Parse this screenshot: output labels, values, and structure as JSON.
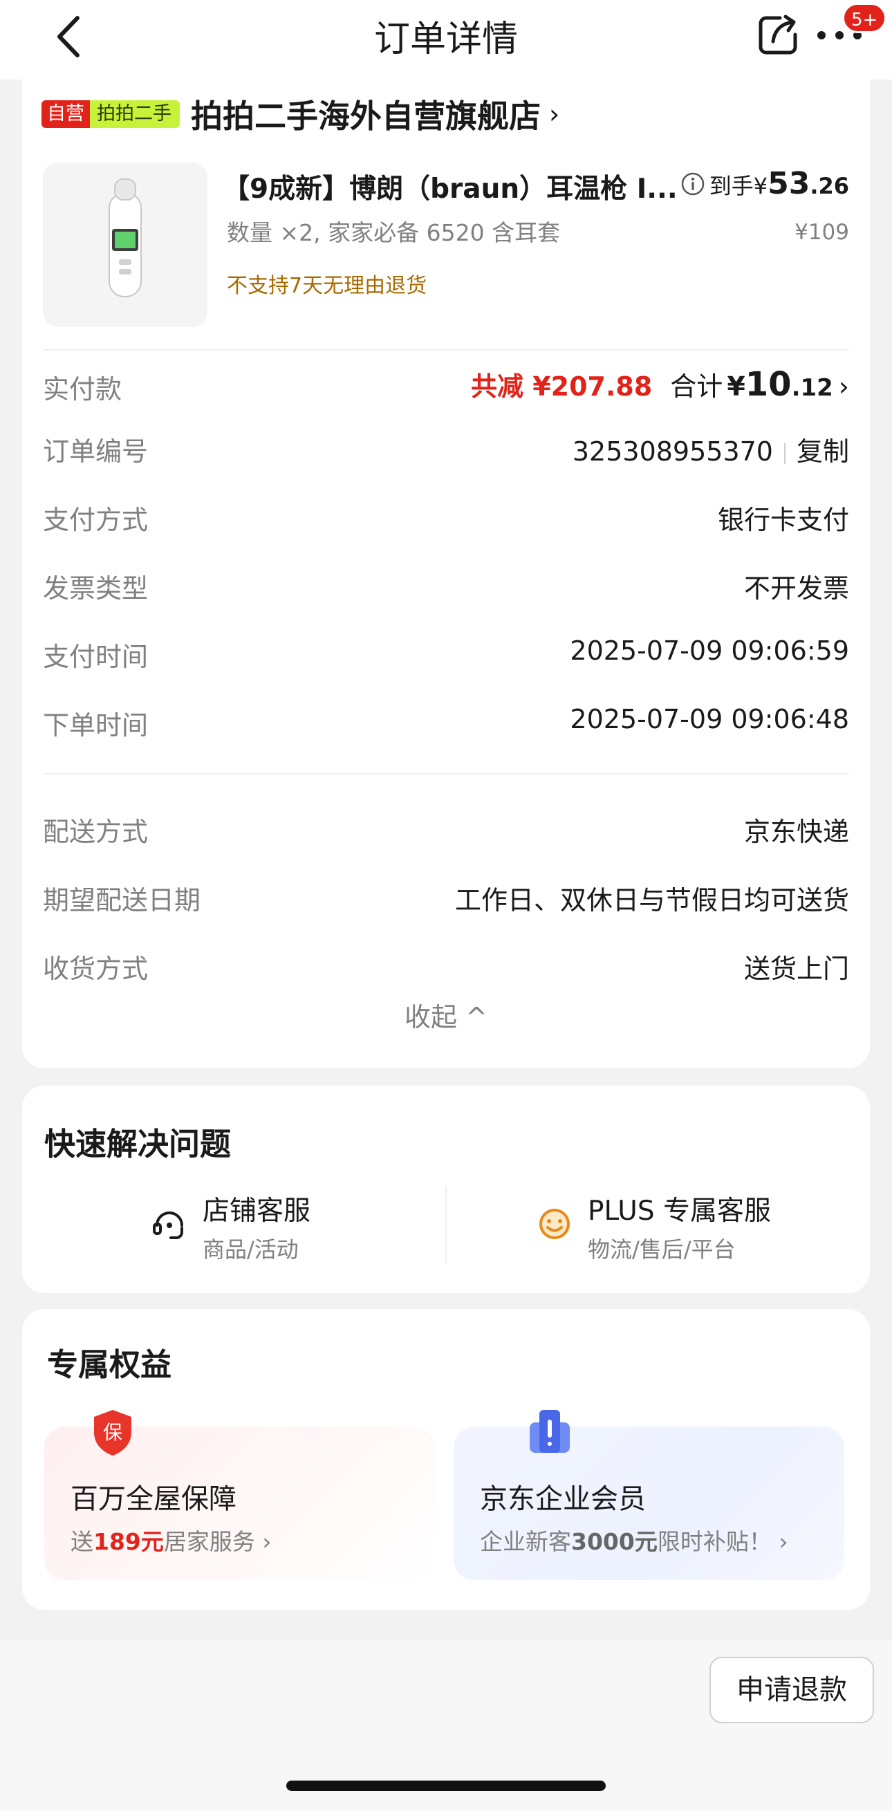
{
  "nav": {
    "title": "订单详情",
    "badge": "5+"
  },
  "store": {
    "tag_self": "自营",
    "tag_second": "拍拍二手",
    "name": "拍拍二手海外自营旗舰店",
    "arrow": "›"
  },
  "product": {
    "title": "【9成新】博朗（braun）耳温枪 I...",
    "spec": "数量 ×2, 家家必备 6520 含耳套",
    "policy": "不支持7天无理由退货",
    "price_label": "到手",
    "price_yen": "¥",
    "price_int": "53",
    "price_dec": ".26",
    "original_price": "¥109"
  },
  "payment": {
    "label": "实付款",
    "reduce": "共减 ¥207.88",
    "sum_label": "合计",
    "sum_yen": "¥",
    "sum_int": "10",
    "sum_dec": ".12",
    "arrow": "›"
  },
  "details": [
    {
      "label": "订单编号",
      "value": "325308955370"
    },
    {
      "label": "支付方式",
      "value": "银行卡支付"
    },
    {
      "label": "发票类型",
      "value": "不开发票"
    },
    {
      "label": "支付时间",
      "value": "2025-07-09 09:06:59"
    },
    {
      "label": "下单时间",
      "value": "2025-07-09 09:06:48"
    },
    {
      "label": "配送方式",
      "value": "京东快递"
    },
    {
      "label": "期望配送日期",
      "value": "工作日、双休日与节假日均可送货"
    },
    {
      "label": "收货方式",
      "value": "送货上门"
    }
  ],
  "copy_label": "复制",
  "collapse_label": "收起 ^",
  "quick": {
    "title": "快速解决问题",
    "services": [
      {
        "title": "店铺客服",
        "sub": "商品/活动"
      },
      {
        "title": "PLUS 专属客服",
        "sub": "物流/售后/平台"
      }
    ]
  },
  "benefits": {
    "title": "专属权益",
    "items": [
      {
        "title": "百万全屋保障",
        "sub_pre": "送",
        "sub_hl": "189元",
        "sub_post": "居家服务 ›"
      },
      {
        "title": "京东企业会员",
        "sub_pre": "企业新客",
        "sub_hl": "3000元",
        "sub_post": "限时补贴！ ›"
      }
    ],
    "badge_bao": "保"
  },
  "bottom": {
    "refund": "申请退款"
  },
  "colors": {
    "accent_red": "#e2231a",
    "tag_green": "#c7f23a",
    "policy_brown": "#a86a00"
  }
}
